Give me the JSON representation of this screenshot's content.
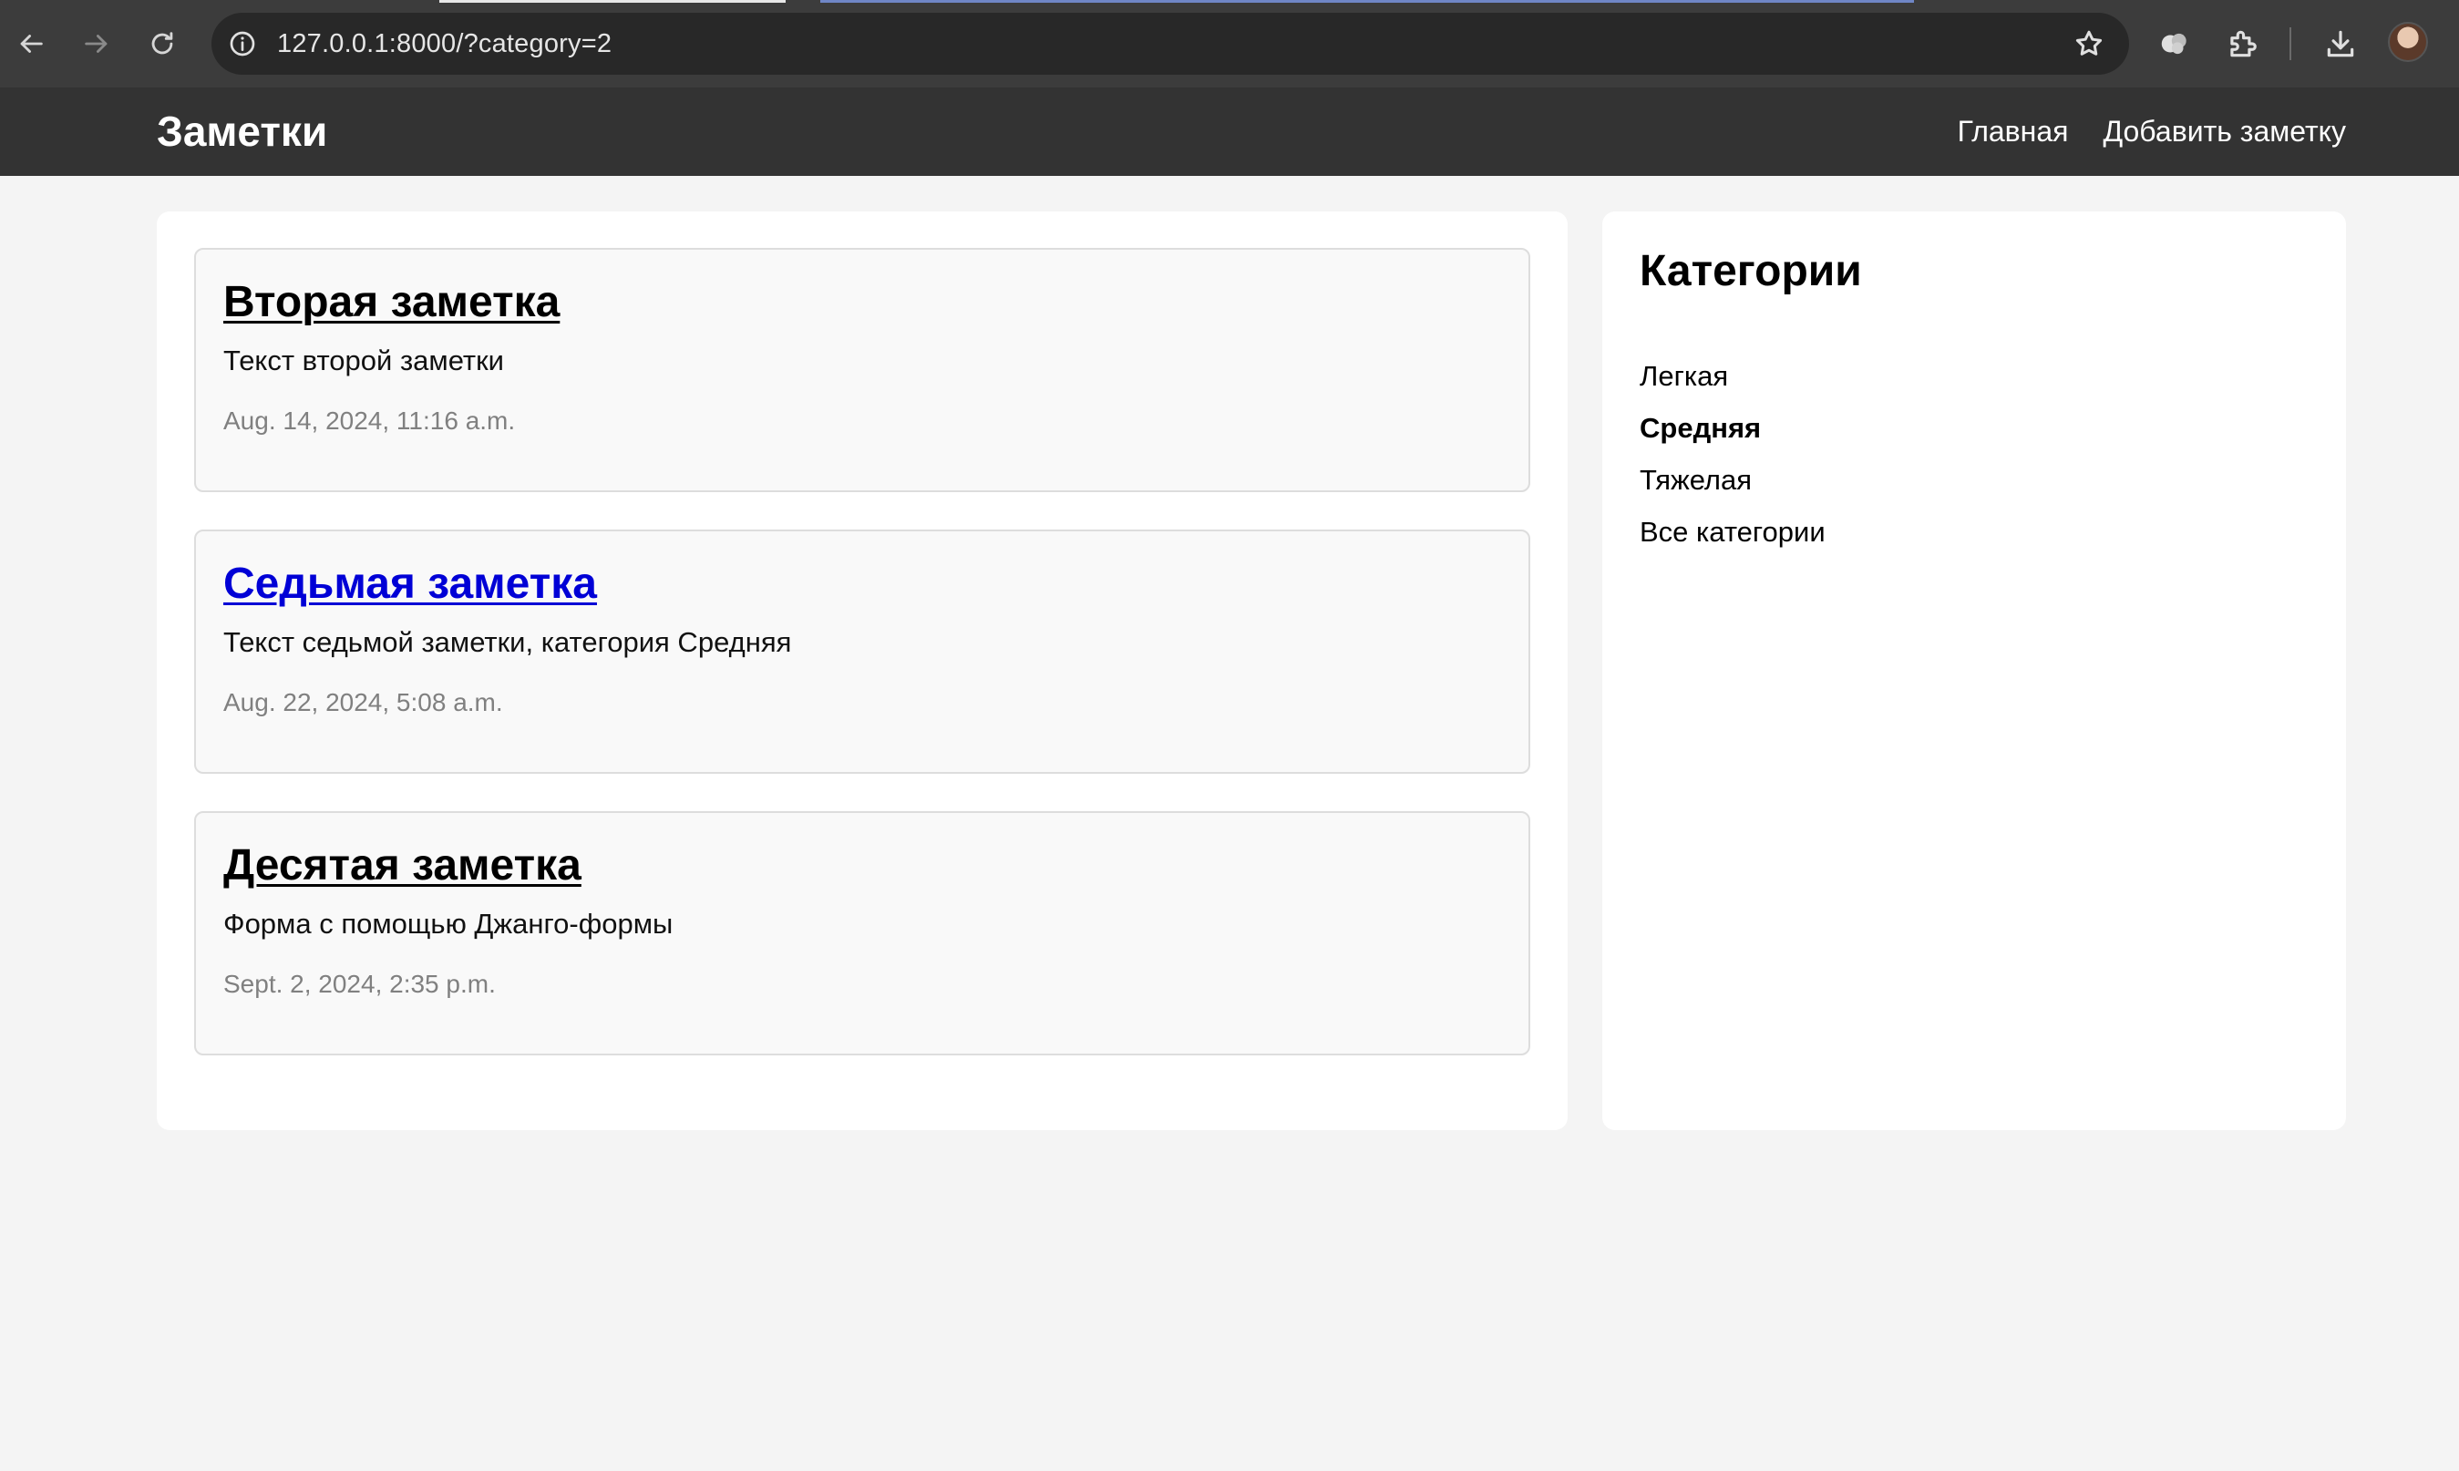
{
  "browser": {
    "url": "127.0.0.1:8000/?category=2"
  },
  "header": {
    "title": "Заметки",
    "nav": [
      {
        "label": "Главная"
      },
      {
        "label": "Добавить заметку"
      }
    ]
  },
  "notes": [
    {
      "title": "Вторая заметка",
      "text": "Текст второй заметки",
      "date": "Aug. 14, 2024, 11:16 a.m."
    },
    {
      "title": "Седьмая заметка",
      "text": "Текст седьмой заметки, категория Средняя",
      "date": "Aug. 22, 2024, 5:08 a.m."
    },
    {
      "title": "Десятая заметка",
      "text": "Форма с помощью Джанго-формы",
      "date": "Sept. 2, 2024, 2:35 p.m."
    }
  ],
  "categories": {
    "heading": "Категории",
    "items": [
      {
        "label": "Легкая"
      },
      {
        "label": "Средняя"
      },
      {
        "label": "Тяжелая"
      },
      {
        "label": "Все категории"
      }
    ]
  },
  "colors": {
    "header_bg": "#333333",
    "page_bg": "#f4f4f4",
    "link_hover": "#0000d6"
  }
}
